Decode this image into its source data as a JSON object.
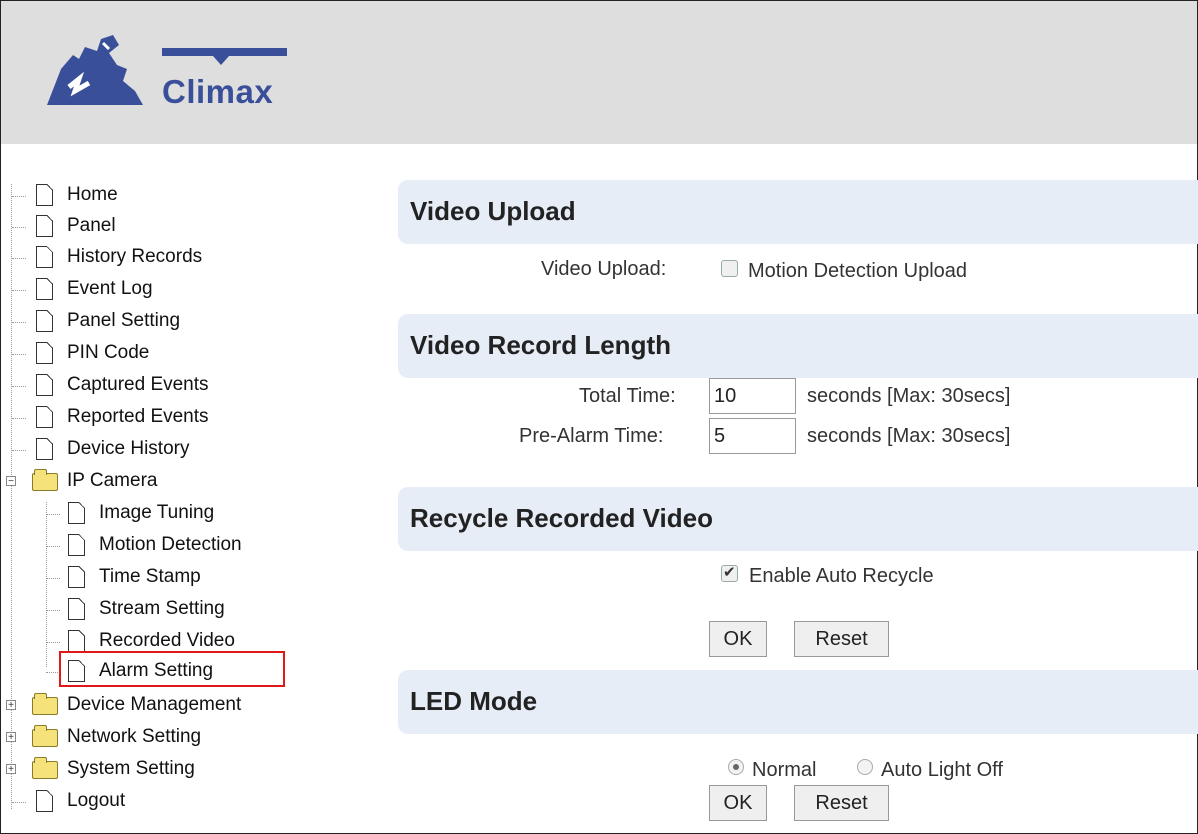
{
  "header": {
    "logo_text": "Climax"
  },
  "tree": {
    "items": [
      {
        "label": "Home"
      },
      {
        "label": "Panel"
      },
      {
        "label": "History Records"
      },
      {
        "label": "Event Log"
      },
      {
        "label": "Panel Setting"
      },
      {
        "label": "PIN Code"
      },
      {
        "label": "Captured Events"
      },
      {
        "label": "Reported Events"
      },
      {
        "label": "Device History"
      },
      {
        "label": "IP Camera"
      },
      {
        "label": "Image Tuning"
      },
      {
        "label": "Motion Detection"
      },
      {
        "label": "Time Stamp"
      },
      {
        "label": "Stream Setting"
      },
      {
        "label": "Recorded Video"
      },
      {
        "label": "Alarm Setting"
      },
      {
        "label": "Device Management"
      },
      {
        "label": "Network Setting"
      },
      {
        "label": "System Setting"
      },
      {
        "label": "Logout"
      }
    ],
    "collapse_symbol": "−",
    "expand_symbol": "+"
  },
  "video_upload": {
    "title": "Video Upload",
    "field_label": "Video Upload:",
    "checkbox_label": "Motion Detection Upload",
    "checked": false
  },
  "video_record_length": {
    "title": "Video Record Length",
    "total_time_label": "Total Time:",
    "total_time_value": "10",
    "total_time_hint": "seconds [Max: 30secs]",
    "pre_alarm_label": "Pre-Alarm Time:",
    "pre_alarm_value": "5",
    "pre_alarm_hint": "seconds [Max: 30secs]"
  },
  "recycle": {
    "title": "Recycle Recorded Video",
    "checkbox_label": "Enable Auto Recycle",
    "checked": true,
    "ok_label": "OK",
    "reset_label": "Reset"
  },
  "led_mode": {
    "title": "LED Mode",
    "option_normal": "Normal",
    "option_auto": "Auto Light Off",
    "selected": "Normal",
    "ok_label": "OK",
    "reset_label": "Reset"
  },
  "colors": {
    "section_bg": "#e7edf7",
    "highlight": "#e01818",
    "header_bg": "#dedede",
    "logo_blue": "#3a4f9a"
  }
}
